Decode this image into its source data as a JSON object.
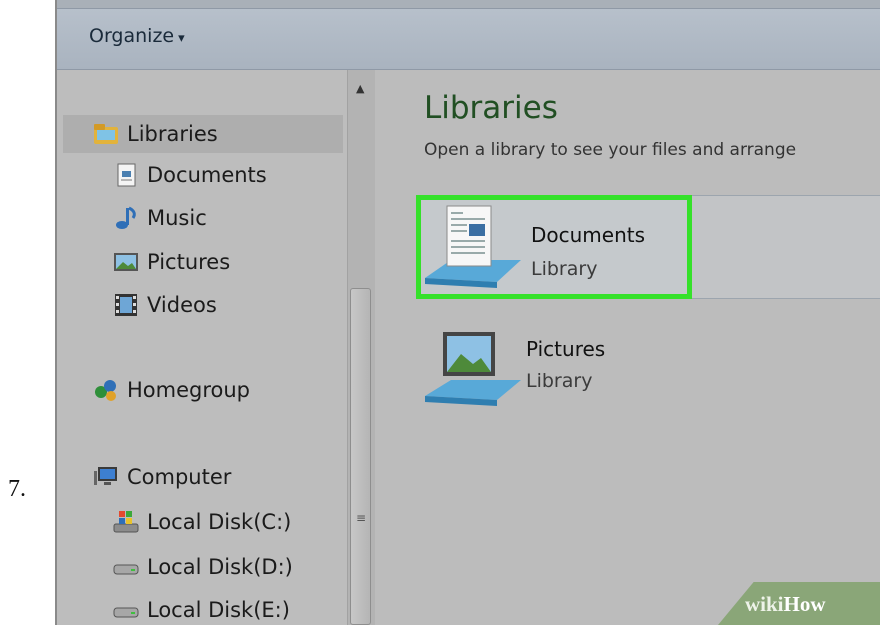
{
  "step_number": "7.",
  "toolbar": {
    "organize_label": "Organize",
    "organize_caret": "▾"
  },
  "nav": {
    "items": [
      {
        "label": "Libraries",
        "icon": "libraries-icon",
        "selected": true
      },
      {
        "label": "Documents",
        "icon": "documents-icon"
      },
      {
        "label": "Music",
        "icon": "music-icon"
      },
      {
        "label": "Pictures",
        "icon": "pictures-icon"
      },
      {
        "label": "Videos",
        "icon": "videos-icon"
      },
      {
        "label": "Homegroup",
        "icon": "homegroup-icon"
      },
      {
        "label": "Computer",
        "icon": "computer-icon"
      },
      {
        "label": "Local Disk(C:)",
        "icon": "windows-drive-icon"
      },
      {
        "label": "Local Disk(D:)",
        "icon": "drive-icon"
      },
      {
        "label": "Local Disk(E:)",
        "icon": "drive-icon"
      }
    ]
  },
  "scrollbar": {
    "up_arrow": "▲",
    "grip": "≡"
  },
  "content": {
    "title": "Libraries",
    "subtitle": "Open a library to see your files and arrange",
    "libraries": [
      {
        "name": "Documents",
        "type": "Library",
        "icon": "documents-library-icon",
        "highlighted": true
      },
      {
        "name": "Pictures",
        "type": "Library",
        "icon": "pictures-library-icon",
        "highlighted": false
      }
    ]
  },
  "watermark": {
    "part1": "wiki",
    "part2": "How"
  },
  "colors": {
    "highlight": "#35e12a",
    "title_green": "#214f23",
    "watermark_bg": "#8aa678"
  }
}
